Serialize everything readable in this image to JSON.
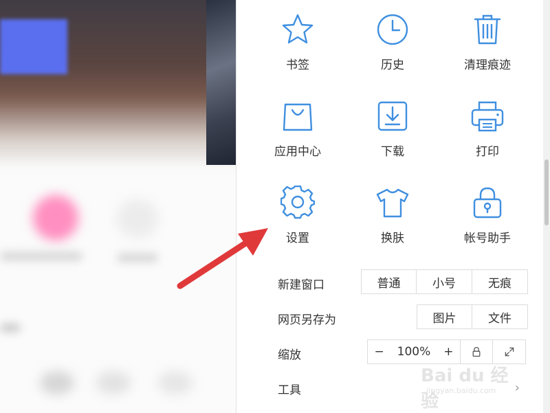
{
  "grid": {
    "bookmarks_label": "书签",
    "history_label": "历史",
    "clear_traces_label": "清理痕迹",
    "app_center_label": "应用中心",
    "download_label": "下载",
    "print_label": "打印",
    "settings_label": "设置",
    "skin_label": "换肤",
    "account_assistant_label": "帐号助手"
  },
  "new_window": {
    "label": "新建窗口",
    "normal": "普通",
    "small": "小号",
    "incognito": "无痕"
  },
  "save_page": {
    "label": "网页另存为",
    "image": "图片",
    "file": "文件"
  },
  "zoom": {
    "label": "缩放",
    "minus": "−",
    "value": "100%",
    "plus": "+"
  },
  "tools": {
    "label": "工具",
    "chevron": "›"
  },
  "watermark": {
    "brand": "Bai du 经验",
    "url": "jingyan.baidu.com"
  },
  "colors": {
    "icon_blue": "#3f8fe0",
    "arrow_red": "#e0393a"
  }
}
